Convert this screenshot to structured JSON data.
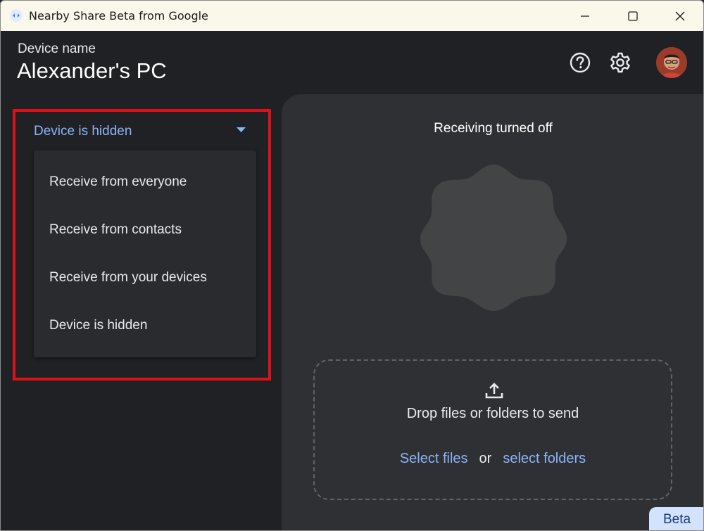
{
  "window": {
    "title": "Nearby Share Beta from Google",
    "controls": {
      "minimize": "minimize-icon",
      "maximize": "maximize-icon",
      "close": "close-icon"
    }
  },
  "header": {
    "device_label": "Device name",
    "device_name": "Alexander's PC",
    "icons": [
      "help-icon",
      "settings-icon",
      "avatar"
    ]
  },
  "visibility": {
    "selected": "Device is hidden",
    "options": [
      "Receive from everyone",
      "Receive from contacts",
      "Receive from your devices",
      "Device is hidden"
    ]
  },
  "receive": {
    "status": "Receiving turned off"
  },
  "send": {
    "drop_text": "Drop files or folders to send",
    "select_files": "Select files",
    "or": "or",
    "select_folders": "select folders"
  },
  "badge": "Beta",
  "colors": {
    "background": "#202124",
    "panel": "#2f3033",
    "accent_link": "#8ab4f8",
    "highlight_border": "#e0101a",
    "beta_badge_bg": "#d3e3fd"
  }
}
